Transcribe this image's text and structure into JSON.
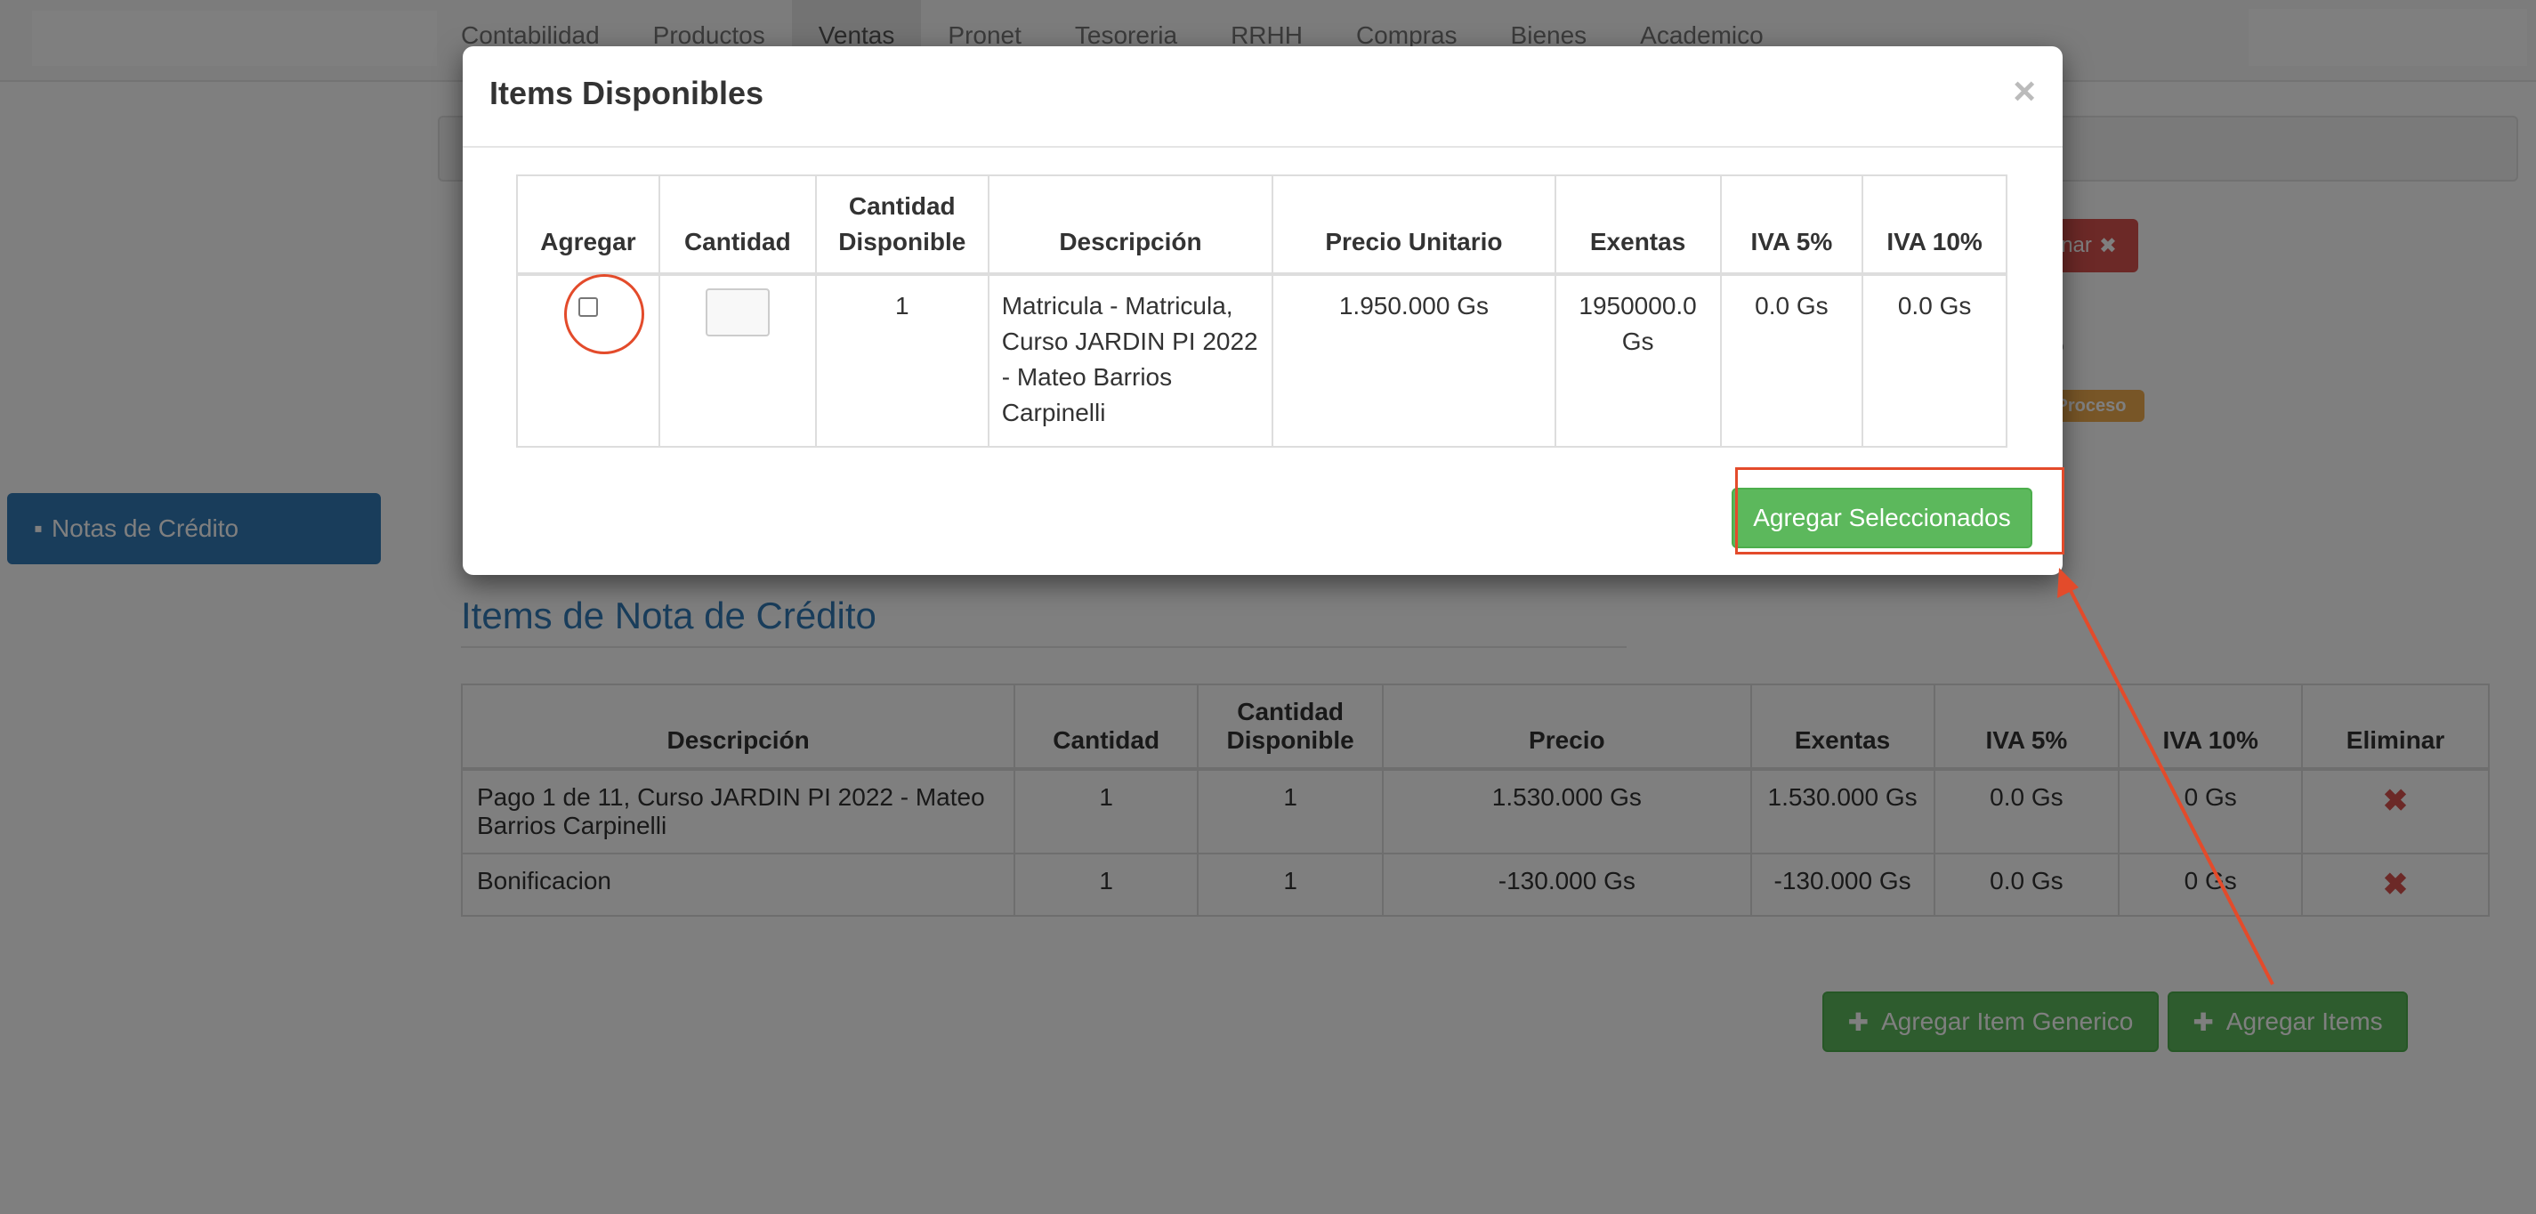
{
  "navbar": {
    "items": [
      "Contabilidad",
      "Productos",
      "Ventas",
      "Pronet",
      "Tesoreria",
      "RRHH",
      "Compras",
      "Bienes",
      "Academico"
    ],
    "active": "Ventas"
  },
  "background": {
    "eliminar_partial": "inar",
    "estado_partial": "ado",
    "badge_partial": "Proceso",
    "sidebar_button": "Notas de Crédito",
    "section_title": "Items de Nota de Crédito",
    "table": {
      "headers": [
        "Descripción",
        "Cantidad",
        "Cantidad Disponible",
        "Precio",
        "Exentas",
        "IVA 5%",
        "IVA 10%",
        "Eliminar"
      ],
      "rows": [
        {
          "descripcion": "Pago 1 de 11, Curso JARDIN PI 2022 - Mateo Barrios Carpinelli",
          "cantidad": "1",
          "disponible": "1",
          "precio": "1.530.000 Gs",
          "exentas": "1.530.000 Gs",
          "iva5": "0.0 Gs",
          "iva10": "0 Gs"
        },
        {
          "descripcion": "Bonificacion",
          "cantidad": "1",
          "disponible": "1",
          "precio": "-130.000 Gs",
          "exentas": "-130.000 Gs",
          "iva5": "0.0 Gs",
          "iva10": "0 Gs"
        }
      ]
    },
    "btn_item_generico": "Agregar Item Generico",
    "btn_agregar_items": "Agregar Items"
  },
  "modal": {
    "title": "Items Disponibles",
    "close": "×",
    "table": {
      "headers": [
        "Agregar",
        "Cantidad",
        "Cantidad Disponible",
        "Descripción",
        "Precio Unitario",
        "Exentas",
        "IVA 5%",
        "IVA 10%"
      ],
      "row": {
        "disponible": "1",
        "descripcion": "Matricula - Matricula, Curso JARDIN PI 2022 - Mateo Barrios Carpinelli",
        "precio": "1.950.000 Gs",
        "exentas": "1950000.0 Gs",
        "iva5": "0.0 Gs",
        "iva10": "0.0 Gs"
      }
    },
    "btn_agregar_seleccionados": "Agregar Seleccionados"
  },
  "colors": {
    "primary": "#337ab7",
    "success": "#5cb85c",
    "danger": "#d9534f",
    "warning": "#f0ad4e",
    "annotation": "#e34b2b"
  }
}
